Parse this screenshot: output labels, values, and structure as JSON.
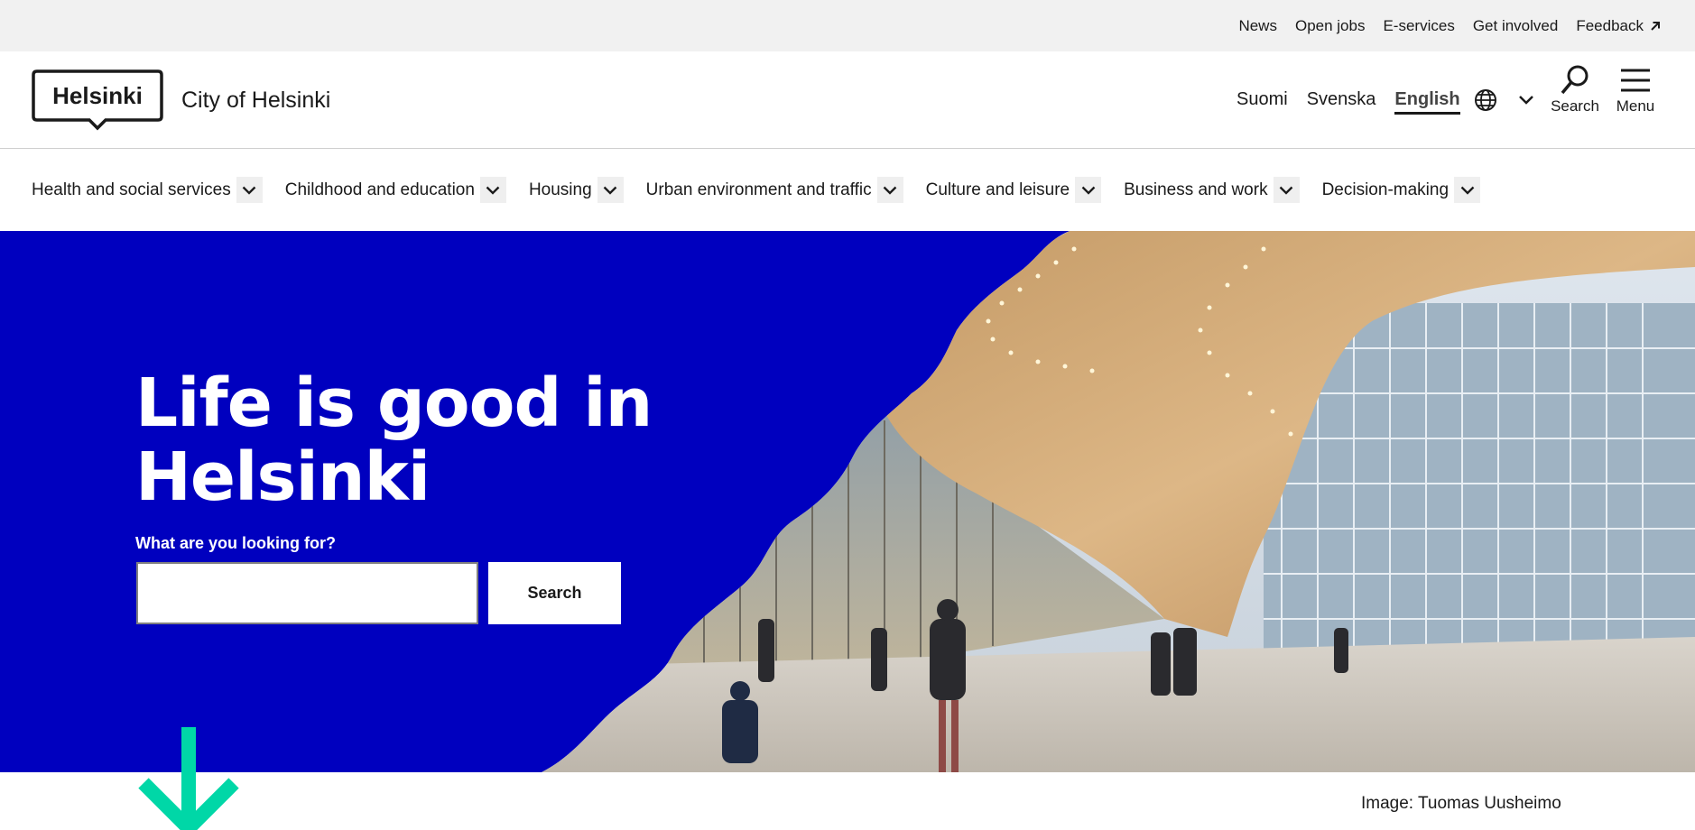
{
  "utility": {
    "links": [
      "News",
      "Open jobs",
      "E-services",
      "Get involved"
    ],
    "feedback_label": "Feedback",
    "feedback_icon": "external-arrow-icon"
  },
  "header": {
    "logo_text": "Helsinki",
    "site_name": "City of Helsinki",
    "languages": [
      "Suomi",
      "Svenska",
      "English"
    ],
    "active_language": "English",
    "globe_icon": "globe-icon",
    "search_label": "Search",
    "menu_label": "Menu"
  },
  "mainnav": {
    "items": [
      {
        "label": "Health and social services"
      },
      {
        "label": "Childhood and education"
      },
      {
        "label": "Housing"
      },
      {
        "label": "Urban environment and traffic"
      },
      {
        "label": "Culture and leisure"
      },
      {
        "label": "Business and work"
      },
      {
        "label": "Decision-making"
      }
    ]
  },
  "hero": {
    "title_line1": "Life is good in",
    "title_line2": "Helsinki",
    "search_label": "What are you looking for?",
    "search_value": "",
    "search_button": "Search",
    "background_color": "#0000bf"
  },
  "credit": "Image: Tuomas Uusheimo",
  "colors": {
    "brand_blue": "#0000bf",
    "accent_green": "#00d7a7",
    "utility_bg": "#f1f1f1"
  }
}
